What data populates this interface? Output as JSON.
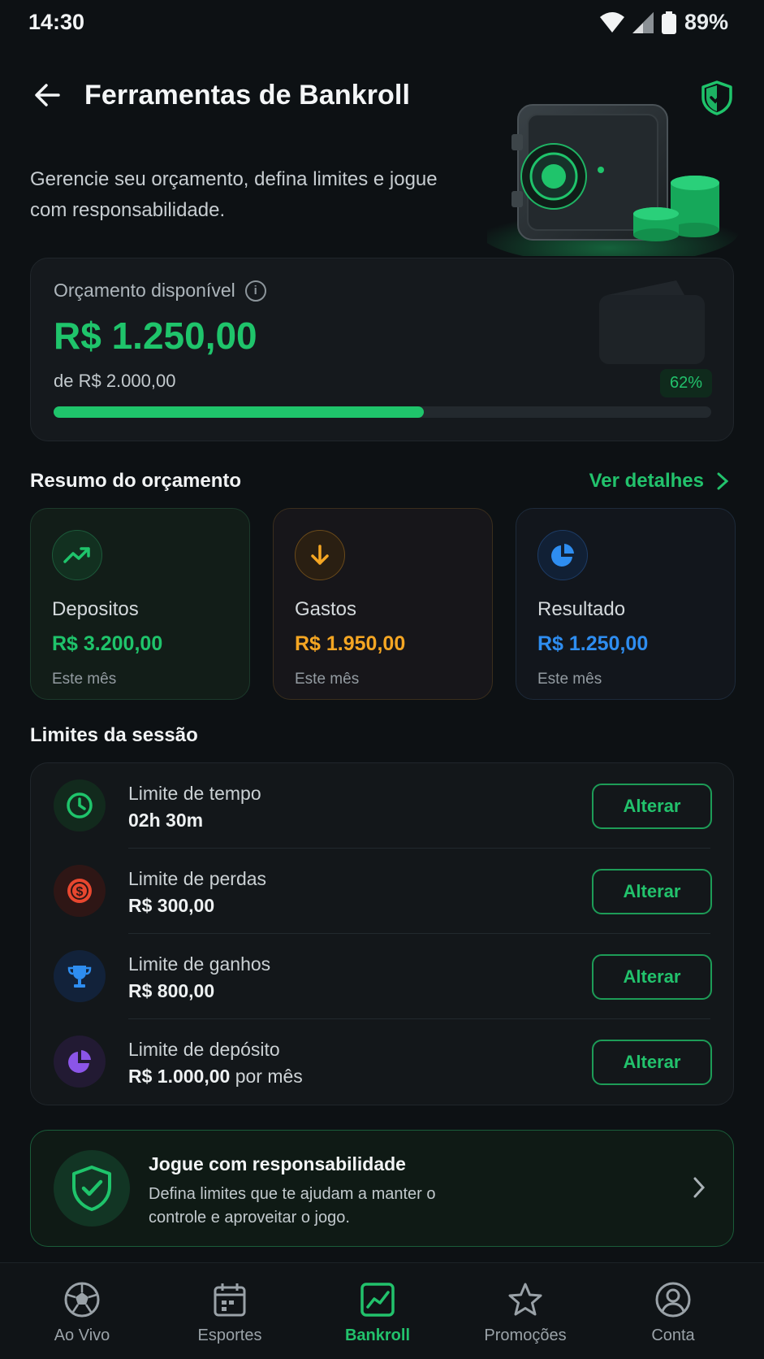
{
  "status_bar": {
    "time": "14:30",
    "battery": "89%"
  },
  "header": {
    "title": "Ferramentas de Bankroll",
    "subtitle": "Gerencie seu orçamento, defina limites e jogue com responsabilidade."
  },
  "budget": {
    "label": "Orçamento disponível",
    "value": "R$ 1.250,00",
    "total": "de R$ 2.000,00",
    "percent_label": "62%",
    "progress_fraction": 0.5625
  },
  "summary": {
    "title": "Resumo do orçamento",
    "link": "Ver detalhes",
    "cards": [
      {
        "label": "Depositos",
        "value": "R$ 3.200,00",
        "period": "Este mês",
        "color": "#1fc46b",
        "icon": "trending-up-icon"
      },
      {
        "label": "Gastos",
        "value": "R$ 1.950,00",
        "period": "Este mês",
        "color": "#f5a623",
        "icon": "arrow-down-icon"
      },
      {
        "label": "Resultado",
        "value": "R$ 1.250,00",
        "period": "Este mês",
        "color": "#2e8df0",
        "icon": "pie-chart-icon"
      }
    ]
  },
  "limits": {
    "title": "Limites da sessão",
    "items": [
      {
        "label": "Limite de tempo",
        "value": "02h 30m",
        "suffix": "",
        "button": "Alterar",
        "icon": "clock-icon",
        "color": "#1fc46b"
      },
      {
        "label": "Limite de perdas",
        "value": "R$ 300,00",
        "suffix": "",
        "button": "Alterar",
        "icon": "dollar-coin-icon",
        "color": "#e8472f"
      },
      {
        "label": "Limite de ganhos",
        "value": "R$ 800,00",
        "suffix": "",
        "button": "Alterar",
        "icon": "trophy-icon",
        "color": "#2e8df0"
      },
      {
        "label": "Limite de depósito",
        "value": "R$ 1.000,00",
        "suffix": " por mês",
        "button": "Alterar",
        "icon": "pie-chart-icon",
        "color": "#8b55e8"
      }
    ]
  },
  "responsible": {
    "title": "Jogue com responsabilidade",
    "text": "Defina limites que te ajudam a manter o controle e aproveitar o jogo."
  },
  "bottom_nav": {
    "items": [
      {
        "label": "Ao Vivo",
        "icon": "soccer-ball-icon",
        "active": false
      },
      {
        "label": "Esportes",
        "icon": "calendar-icon",
        "active": false
      },
      {
        "label": "Bankroll",
        "icon": "chart-icon",
        "active": true
      },
      {
        "label": "Promoções",
        "icon": "star-icon",
        "active": false
      },
      {
        "label": "Conta",
        "icon": "user-icon",
        "active": false
      }
    ]
  },
  "colors": {
    "accent": "#1fc46b",
    "background": "#0d1114"
  }
}
